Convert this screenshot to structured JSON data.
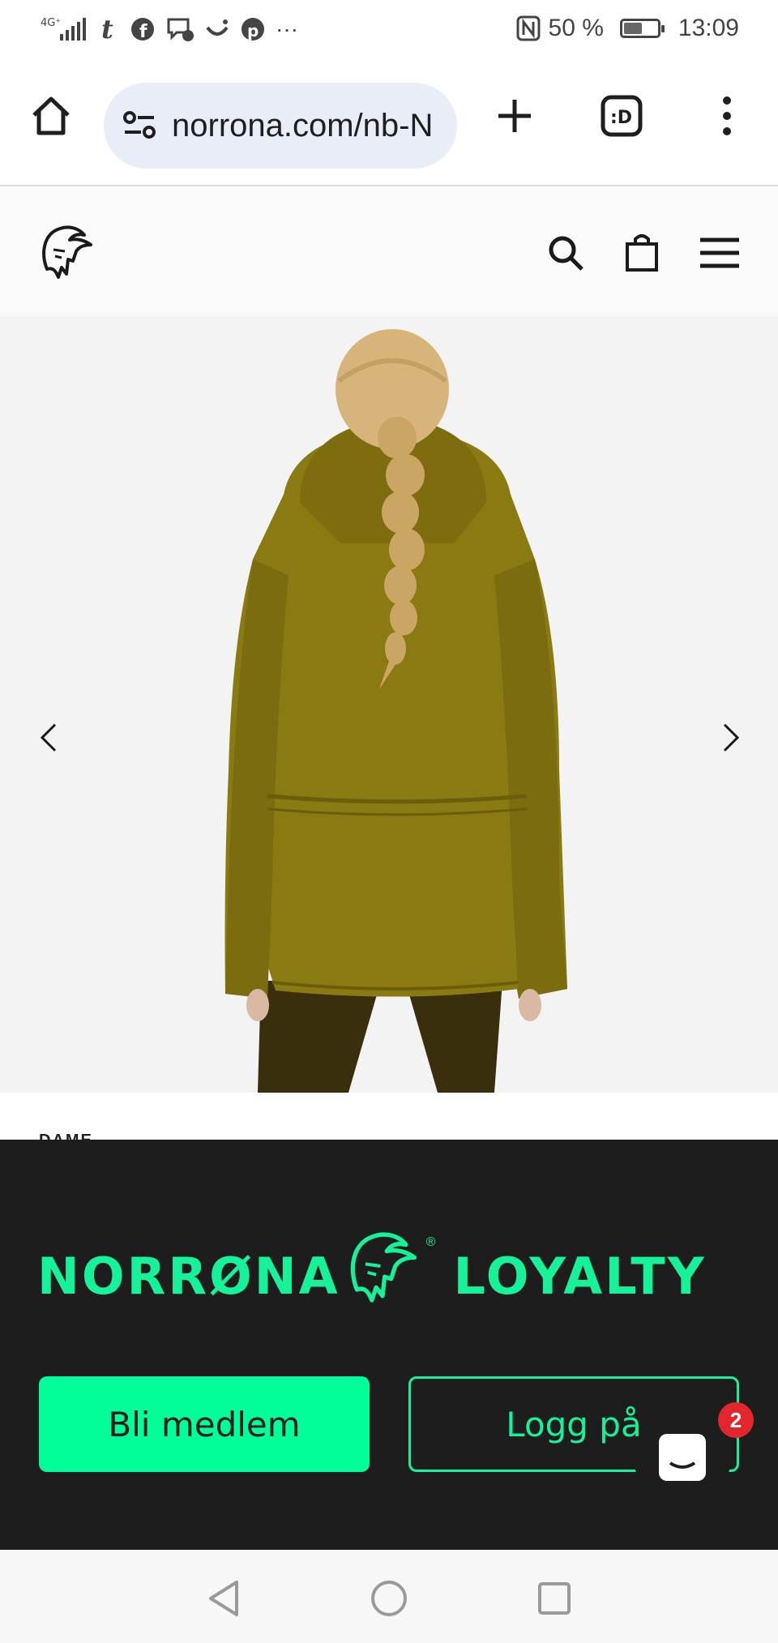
{
  "status_bar": {
    "network": "4G⁺",
    "battery_percent": "50 %",
    "battery_level": 0.5,
    "time": "13:09",
    "notification_icons": [
      "tumblr-icon",
      "facebook-icon",
      "messenger-icon",
      "smile-icon",
      "pinterest-icon",
      "more-icon"
    ],
    "more": "···"
  },
  "browser": {
    "url": "norrona.com/nb-N",
    "tab_count_label": ":D"
  },
  "product": {
    "category_peek": "DAME",
    "jacket_color": "#8a7a12"
  },
  "loyalty": {
    "brand_left": "NORRØNA",
    "brand_right": "LOYALTY",
    "registered": "®",
    "join_label": "Bli medlem",
    "login_label": "Logg på",
    "accent_color": "#15f29a"
  },
  "chat": {
    "unread_count": "2"
  }
}
